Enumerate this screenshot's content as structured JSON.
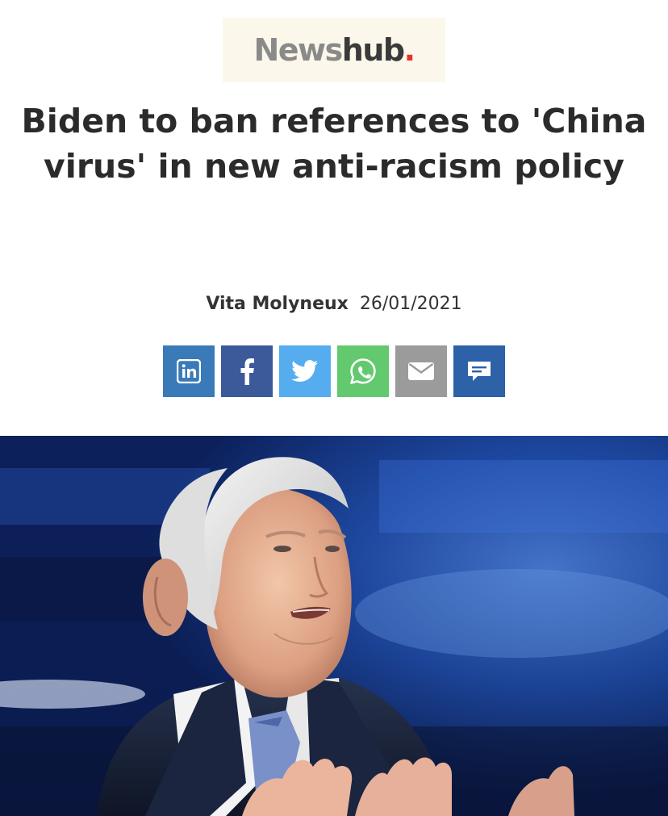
{
  "brand": {
    "name_part1": "News",
    "name_part2": "hub",
    "name_dot": "."
  },
  "article": {
    "headline": "Biden to ban references to 'China virus' in new anti-racism policy",
    "author": "Vita Molyneux",
    "date": "26/01/2021"
  },
  "share": {
    "buttons": [
      {
        "network": "linkedin",
        "icon": "linkedin-icon",
        "color": "#3a7ab8"
      },
      {
        "network": "facebook",
        "icon": "facebook-icon",
        "color": "#3c5a9a"
      },
      {
        "network": "twitter",
        "icon": "twitter-icon",
        "color": "#55acee"
      },
      {
        "network": "whatsapp",
        "icon": "whatsapp-icon",
        "color": "#62c96e"
      },
      {
        "network": "email",
        "icon": "email-icon",
        "color": "#9b9b9b"
      },
      {
        "network": "comments",
        "icon": "comment-icon",
        "color": "#2d61a8"
      }
    ]
  },
  "colors": {
    "logo_background": "#fbf7ea",
    "headline_text": "#2b2b2b",
    "accent_red": "#e8322d"
  }
}
